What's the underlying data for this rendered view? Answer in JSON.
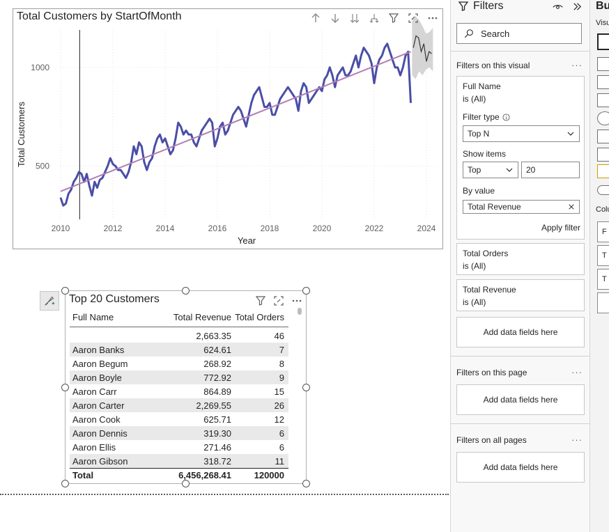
{
  "line_visual": {
    "title": "Total Customers by StartOfMonth"
  },
  "chart_data": {
    "type": "line",
    "xlabel": "Year",
    "ylabel": "Total Customers",
    "x_ticks": [
      "2010",
      "2012",
      "2014",
      "2016",
      "2018",
      "2020",
      "2022",
      "2024"
    ],
    "y_ticks": [
      500,
      1000
    ],
    "xlim": [
      2010,
      2024.4
    ],
    "ylim": [
      230,
      1190
    ],
    "colors": {
      "series": "#4a4ea6",
      "trend": "#b07fb5",
      "forecast": "#333333",
      "band": "#d0d0d0"
    },
    "series": [
      {
        "x": [
          2010.0,
          2010.1,
          2010.2,
          2010.3,
          2010.4,
          2010.5,
          2010.6,
          2010.7,
          2010.8,
          2010.9,
          2011.0,
          2011.1,
          2011.2,
          2011.3,
          2011.4,
          2011.5,
          2011.6,
          2011.7,
          2011.8,
          2011.9,
          2012.0,
          2012.1,
          2012.2,
          2012.3,
          2012.4,
          2012.5,
          2012.6,
          2012.7,
          2012.8,
          2012.9,
          2013.0,
          2013.1,
          2013.2,
          2013.3,
          2013.4,
          2013.5,
          2013.6,
          2013.7,
          2013.8,
          2013.9,
          2014.0,
          2014.1,
          2014.2,
          2014.3,
          2014.4,
          2014.5,
          2014.6,
          2014.7,
          2014.8,
          2014.9,
          2015.0,
          2015.1,
          2015.2,
          2015.3,
          2015.4,
          2015.5,
          2015.6,
          2015.7,
          2015.8,
          2015.9,
          2016.0,
          2016.1,
          2016.2,
          2016.3,
          2016.4,
          2016.5,
          2016.6,
          2016.7,
          2016.8,
          2016.9,
          2017.0,
          2017.1,
          2017.2,
          2017.3,
          2017.4,
          2017.5,
          2017.6,
          2017.7,
          2017.8,
          2017.9,
          2018.0,
          2018.1,
          2018.2,
          2018.3,
          2018.4,
          2018.5,
          2018.6,
          2018.7,
          2018.8,
          2018.9,
          2019.0,
          2019.1,
          2019.2,
          2019.3,
          2019.4,
          2019.5,
          2019.6,
          2019.7,
          2019.8,
          2019.9,
          2020.0,
          2020.1,
          2020.2,
          2020.3,
          2020.4,
          2020.5,
          2020.6,
          2020.7,
          2020.8,
          2020.9,
          2021.0,
          2021.1,
          2021.2,
          2021.3,
          2021.4,
          2021.5,
          2021.6,
          2021.7,
          2021.8,
          2021.9,
          2022.0,
          2022.1,
          2022.2,
          2022.3,
          2022.4,
          2022.5,
          2022.6,
          2022.7,
          2022.8,
          2022.9,
          2023.0,
          2023.1,
          2023.2,
          2023.3,
          2023.4
        ],
        "values": [
          340,
          300,
          310,
          360,
          380,
          420,
          440,
          470,
          460,
          420,
          460,
          400,
          350,
          420,
          390,
          430,
          440,
          470,
          500,
          540,
          510,
          500,
          480,
          480,
          460,
          440,
          470,
          520,
          600,
          560,
          620,
          600,
          520,
          480,
          520,
          540,
          600,
          640,
          660,
          620,
          640,
          600,
          560,
          580,
          640,
          720,
          700,
          660,
          680,
          660,
          660,
          620,
          600,
          640,
          680,
          700,
          720,
          740,
          720,
          600,
          640,
          700,
          720,
          660,
          680,
          720,
          760,
          780,
          800,
          780,
          740,
          700,
          760,
          820,
          860,
          880,
          900,
          850,
          800,
          800,
          820,
          760,
          760,
          800,
          840,
          860,
          880,
          900,
          880,
          860,
          840,
          780,
          880,
          920,
          900,
          820,
          840,
          860,
          880,
          900,
          880,
          940,
          960,
          1000,
          960,
          900,
          960,
          980,
          1000,
          960,
          960,
          980,
          1020,
          1060,
          1000,
          1060,
          1100,
          1080,
          1060,
          1020,
          920,
          1000,
          1040,
          1060,
          1100,
          1120,
          1080,
          1040,
          1000,
          1000,
          960,
          1000,
          1060,
          1080,
          820
        ]
      },
      {
        "name": "",
        "x": [
          2010.0,
          2023.4
        ],
        "values": [
          372,
          1080
        ]
      },
      {
        "name": "",
        "x": [
          2023.5,
          2023.6,
          2023.7,
          2023.8,
          2023.9,
          2024.0,
          2024.1,
          2024.2
        ],
        "values": [
          1100,
          1160,
          1150,
          1080,
          1120,
          1030,
          1080,
          1070
        ]
      }
    ],
    "reference_line_x": 2010.73,
    "forecast_band": {
      "x_start": 2023.45,
      "x_end": 2024.25,
      "upper": [
        1250,
        1260,
        1240,
        1210,
        1170,
        1180,
        1200
      ],
      "lower": [
        960,
        940,
        980,
        960,
        990,
        1000,
        980
      ]
    },
    "grid": true
  },
  "table_visual": {
    "title": "Top 20 Customers",
    "columns": [
      "Full Name",
      "Total Revenue",
      "Total Orders"
    ],
    "rows": [
      {
        "name": "",
        "revenue": "2,663.35",
        "orders": "46"
      },
      {
        "name": "Aaron Banks",
        "revenue": "624.61",
        "orders": "7"
      },
      {
        "name": "Aaron Begum",
        "revenue": "268.92",
        "orders": "8"
      },
      {
        "name": "Aaron Boyle",
        "revenue": "772.92",
        "orders": "9"
      },
      {
        "name": "Aaron Carr",
        "revenue": "864.89",
        "orders": "15"
      },
      {
        "name": "Aaron Carter",
        "revenue": "2,269.55",
        "orders": "26"
      },
      {
        "name": "Aaron Cook",
        "revenue": "625.71",
        "orders": "12"
      },
      {
        "name": "Aaron Dennis",
        "revenue": "319.30",
        "orders": "6"
      },
      {
        "name": "Aaron Ellis",
        "revenue": "271.46",
        "orders": "6"
      },
      {
        "name": "Aaron Gibson",
        "revenue": "318.72",
        "orders": "11"
      }
    ],
    "total": {
      "label": "Total",
      "revenue": "6,456,268.41",
      "orders": "120000"
    }
  },
  "filters_pane": {
    "title": "Filters",
    "search_placeholder": "Search",
    "section_visual": "Filters on this visual",
    "card_fullname": {
      "field": "Full Name",
      "state": "is (All)",
      "filter_type_label": "Filter type",
      "filter_type_value": "Top N",
      "show_items_label": "Show items",
      "show_items_direction": "Top",
      "show_items_count": "20",
      "by_value_label": "By value",
      "by_value_field": "Total Revenue",
      "apply_label": "Apply filter"
    },
    "card_orders": {
      "field": "Total Orders",
      "state": "is (All)"
    },
    "card_revenue": {
      "field": "Total Revenue",
      "state": "is (All)"
    },
    "add_fields": "Add data fields here",
    "section_page": "Filters on this page",
    "section_all": "Filters on all pages"
  },
  "build_pane": {
    "title": "Bu",
    "visu_label": "Visu",
    "col_label": "Colu",
    "box_letters": [
      "F",
      "T",
      "T"
    ]
  }
}
